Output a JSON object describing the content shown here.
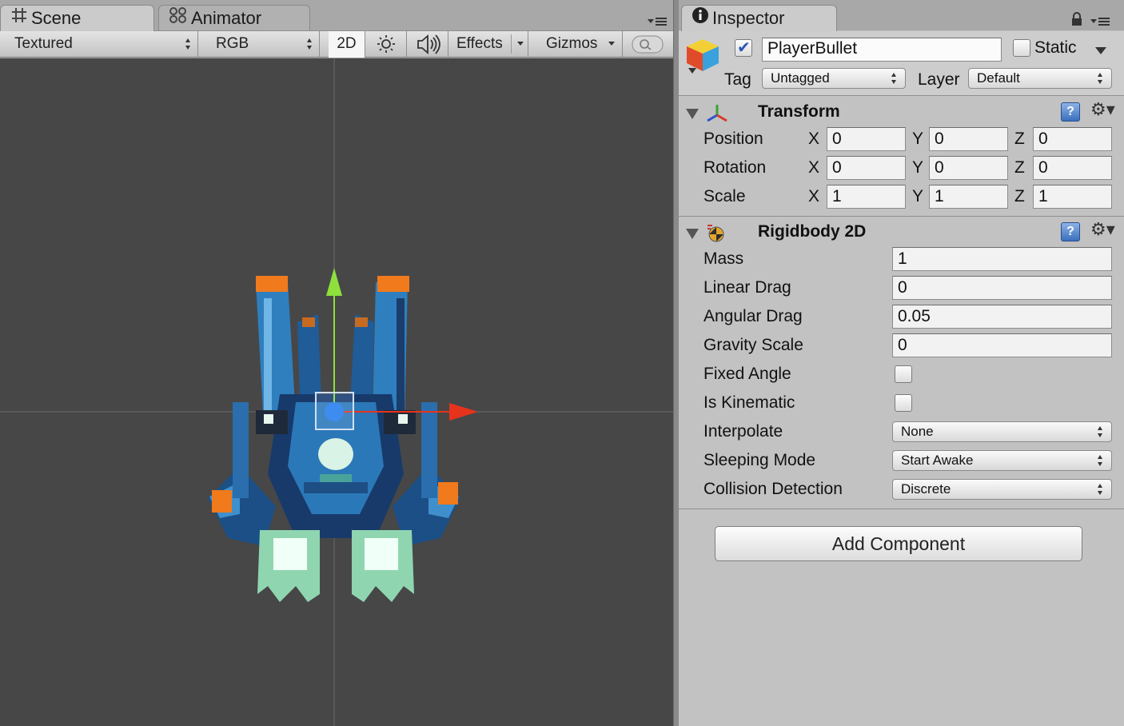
{
  "scene_panel": {
    "tabs": [
      {
        "label": "Scene",
        "icon": "scene-grid-icon"
      },
      {
        "label": "Animator",
        "icon": "animator-icon"
      }
    ],
    "toolbar": {
      "render_mode": "Textured",
      "color_mode": "RGB",
      "mode_2d": "2D",
      "lighting_icon": "sun-icon",
      "audio_icon": "speaker-icon",
      "effects": "Effects",
      "gizmos": "Gizmos",
      "search_icon": "search-icon"
    },
    "gizmo_colors": {
      "x_axis": "#e8331c",
      "y_axis": "#8ee03c",
      "center": "#3d8cf0"
    }
  },
  "inspector": {
    "tab": {
      "label": "Inspector",
      "icon": "info-icon"
    },
    "lock_icon": "lock-icon",
    "object": {
      "icon": "gameobject-cube-icon",
      "active": true,
      "name": "PlayerBullet",
      "static_label": "Static",
      "static": false,
      "tag_label": "Tag",
      "tag": "Untagged",
      "layer_label": "Layer",
      "layer": "Default"
    },
    "transform": {
      "title": "Transform",
      "icon": "transform-axes-icon",
      "rows": [
        {
          "label": "Position",
          "x": "0",
          "y": "0",
          "z": "0"
        },
        {
          "label": "Rotation",
          "x": "0",
          "y": "0",
          "z": "0"
        },
        {
          "label": "Scale",
          "x": "1",
          "y": "1",
          "z": "1"
        }
      ],
      "axis_x": "X",
      "axis_y": "Y",
      "axis_z": "Z"
    },
    "rigidbody": {
      "title": "Rigidbody 2D",
      "icon": "rigidbody2d-icon",
      "mass_label": "Mass",
      "mass": "1",
      "linear_drag_label": "Linear Drag",
      "linear_drag": "0",
      "angular_drag_label": "Angular Drag",
      "angular_drag": "0.05",
      "gravity_scale_label": "Gravity Scale",
      "gravity_scale": "0",
      "fixed_angle_label": "Fixed Angle",
      "fixed_angle": false,
      "is_kinematic_label": "Is Kinematic",
      "is_kinematic": false,
      "interpolate_label": "Interpolate",
      "interpolate": "None",
      "sleeping_mode_label": "Sleeping Mode",
      "sleeping_mode": "Start Awake",
      "collision_detection_label": "Collision Detection",
      "collision_detection": "Discrete"
    },
    "add_component": "Add Component",
    "help_glyph": "?"
  }
}
